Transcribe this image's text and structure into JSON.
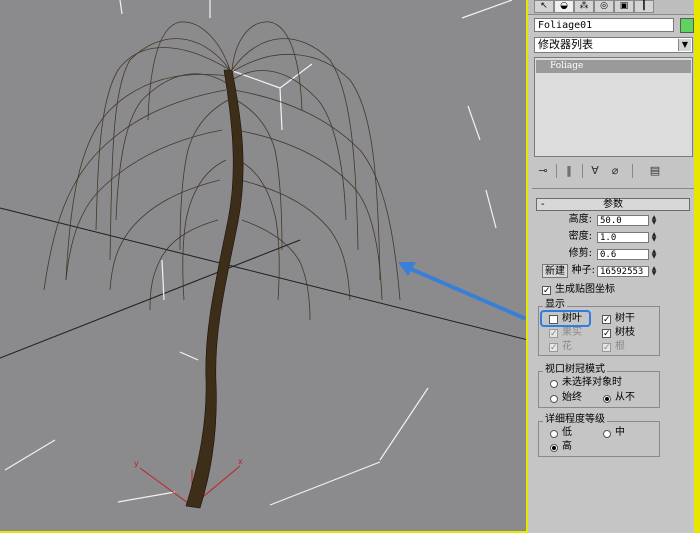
{
  "toolbar": {
    "tabs": [
      {
        "icon": "create-pointer-icon",
        "glyph": "↖"
      },
      {
        "icon": "modify-icon",
        "glyph": "◒"
      },
      {
        "icon": "hierarchy-icon",
        "glyph": "⁂"
      },
      {
        "icon": "motion-icon",
        "glyph": "◎"
      },
      {
        "icon": "display-icon",
        "glyph": "▣"
      },
      {
        "icon": "utilities-icon",
        "glyph": "┃"
      }
    ]
  },
  "object": {
    "name": "Foliage01",
    "color": "#5fd35f"
  },
  "modifier": {
    "list_label": "修改器列表",
    "stack_item": "Foliage"
  },
  "params": {
    "title": "参数",
    "height_label": "高度:",
    "height_value": "50.0",
    "density_label": "密度:",
    "density_value": "1.0",
    "prune_label": "修剪:",
    "prune_value": "0.6",
    "new_label": "新建",
    "seed_label": "种子:",
    "seed_value": "16592553",
    "gen_map_label": "生成贴图坐标"
  },
  "display": {
    "title": "显示",
    "leaves": "树叶",
    "trunk": "树干",
    "fruit": "果实",
    "branches": "树枝",
    "flowers": "花",
    "roots": "根"
  },
  "canopy": {
    "title": "视口树冠模式",
    "when_unselected": "未选择对象时",
    "always": "始终",
    "never": "从不"
  },
  "detail": {
    "title": "详细程度等级",
    "low": "低",
    "medium": "中",
    "high": "高"
  },
  "axis": {
    "x": "x",
    "y": "y"
  },
  "colors": {
    "viewport_border": "#e6e600",
    "highlight": "#2f7de1",
    "viewport_bg": "#8b8a8d"
  }
}
